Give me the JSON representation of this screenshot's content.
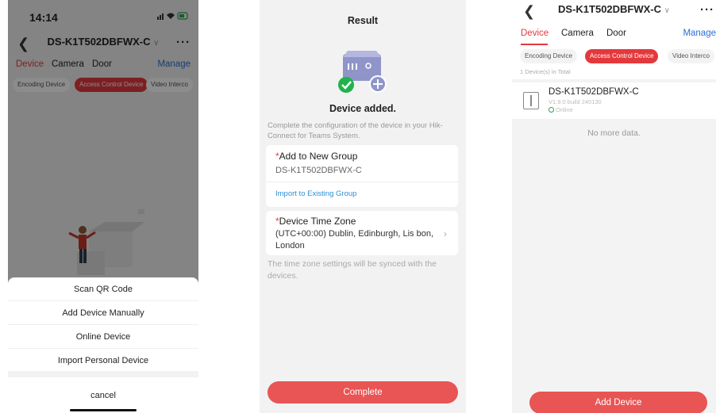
{
  "colors": {
    "accent": "#e4393c",
    "button": "#e95454",
    "link": "#2b8fd6",
    "online": "#2ea44f"
  },
  "screen1": {
    "status_time": "14:14",
    "status_icons": "signal wifi battery",
    "back_icon": "chevron-left-icon",
    "title": "DS-K1T502DBFWX-C",
    "more_icon": "more-icon",
    "tabs": [
      "Device",
      "Camera",
      "Door"
    ],
    "manage": "Manage",
    "chips": [
      "Encoding Device",
      "Access Control Device",
      "Video Interco"
    ],
    "sheet": {
      "items": [
        "Scan QR Code",
        "Add Device Manually",
        "Online Device",
        "Import Personal Device"
      ],
      "cancel": "cancel"
    }
  },
  "screen2": {
    "title": "Result",
    "added": "Device added.",
    "note": "Complete the configuration of the device in your Hik-Connect for Teams System.",
    "group_label": "Add to New Group",
    "group_value": "DS-K1T502DBFWX-C",
    "import_link": "Import to Existing Group",
    "tz_label": "Device Time Zone",
    "tz_value": "(UTC+00:00) Dublin, Edinburgh, Lis bon, London",
    "tz_note": "The time zone settings will be synced with the devices.",
    "complete": "Complete"
  },
  "screen3": {
    "back_icon": "chevron-left-icon",
    "title": "DS-K1T502DBFWX-C",
    "tabs": [
      "Device",
      "Camera",
      "Door"
    ],
    "manage": "Manage",
    "chips": [
      "Encoding Device",
      "Access Control Device",
      "Video Interco"
    ],
    "total": "1 Device(s) in Total",
    "device_name": "DS-K1T502DBFWX-C",
    "device_version": "V1.9.0 build 240130",
    "device_status": "Online",
    "no_more": "No more data.",
    "add_device": "Add Device"
  }
}
